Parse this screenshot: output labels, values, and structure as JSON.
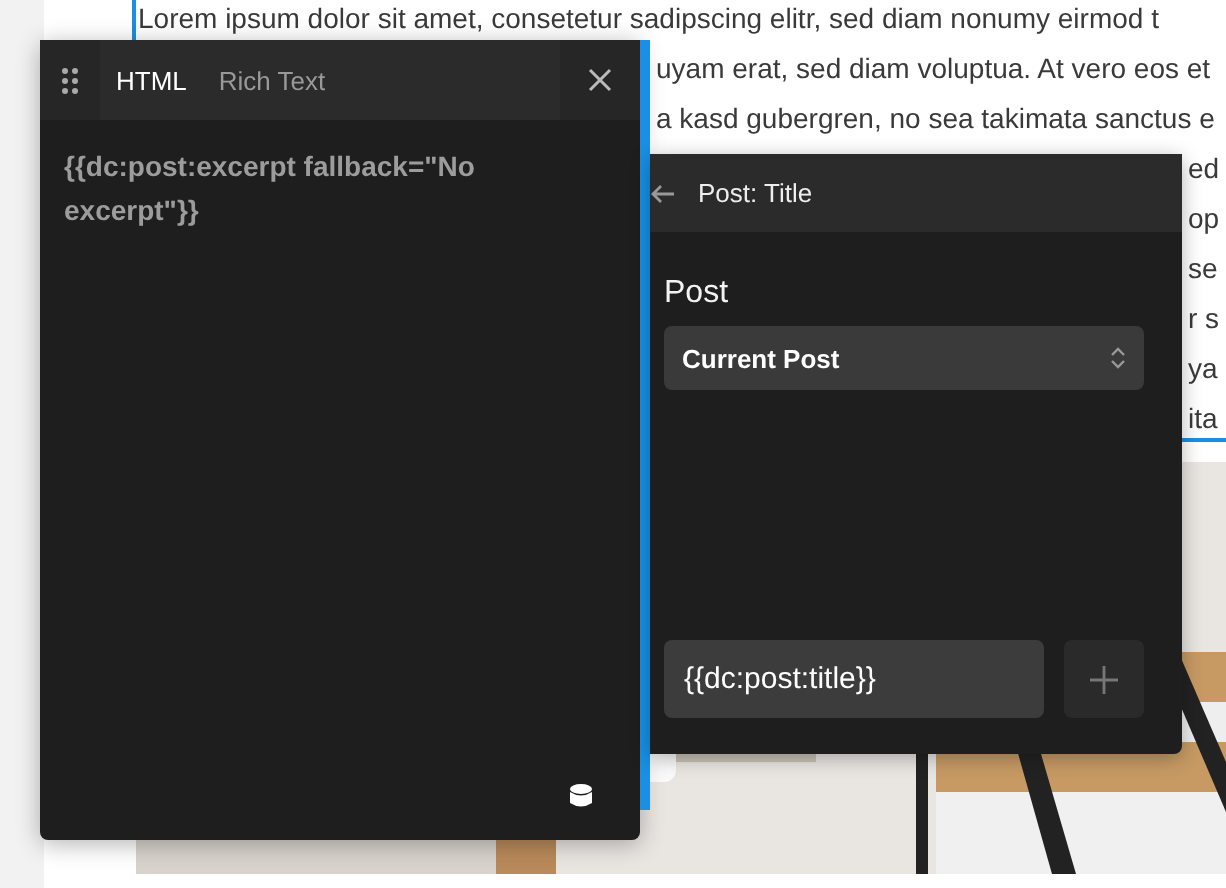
{
  "page_text": [
    {
      "kind": "full",
      "text": "Lorem ipsum dolor sit amet, consetetur sadipscing elitr, sed diam nonumy eirmod t"
    },
    {
      "kind": "middle",
      "text": "uyam erat, sed diam voluptua. At vero eos et"
    },
    {
      "kind": "middle",
      "text": "a kasd gubergren, no sea takimata sanctus e"
    },
    {
      "kind": "edge",
      "text": "ed"
    },
    {
      "kind": "edge",
      "text": "op"
    },
    {
      "kind": "edge",
      "text": "se"
    },
    {
      "kind": "edge",
      "text": "r s"
    },
    {
      "kind": "edge",
      "text": "ya"
    },
    {
      "kind": "edge",
      "text": "ita"
    }
  ],
  "editor": {
    "tabs": [
      {
        "label": "HTML",
        "selected": true
      },
      {
        "label": "Rich Text",
        "selected": false
      }
    ],
    "content": "{{dc:post:excerpt fallback=\"No excerpt\"}}"
  },
  "dynamic_data": {
    "title": "Post: Title",
    "field_label": "Post",
    "select_value": "Current Post",
    "input_value": "{{dc:post:title}}"
  }
}
